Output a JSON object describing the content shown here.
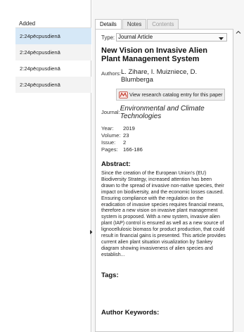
{
  "list": {
    "column_header": "Added",
    "rows": [
      "2:24pēcpusdienā",
      "2:24pēcpusdienā",
      "2:24pēcpusdienā",
      "2:24pēcpusdienā"
    ]
  },
  "tabs": [
    {
      "label": "Details"
    },
    {
      "label": "Notes"
    },
    {
      "label": "Contents"
    }
  ],
  "details": {
    "type_label": "Type:",
    "type_value": "Journal Article",
    "title": "New Vision on Invasive Alien Plant Management System",
    "authors_label": "Authors:",
    "authors_value": "L. Zihare, I. Muizniece, D. Blumberga",
    "catalog_button": "View research catalog entry for this paper",
    "journal_label": "Journal:",
    "journal_value": "Environmental and Climate Technologies",
    "year_label": "Year:",
    "year_value": "2019",
    "volume_label": "Volume:",
    "volume_value": "23",
    "issue_label": "Issue:",
    "issue_value": "2",
    "pages_label": "Pages:",
    "pages_value": "166-186",
    "abstract_heading": "Abstract:",
    "abstract_text": "Since the creation of the European Union's (EU) Biodiversity Strategy, increased attention has been drawn to the spread of invasive non-native species, their impact on biodiversity, and the economic losses caused. Ensuring compliance with the regulation on the eradication of invasive species requires financial means, therefore a new vision on invasive plant management system is proposed. With a new system, invasive alien plant (IAP) control is ensured as well as a new source of lignocellulosic biomass for product production, that could result in financial gains is presented. This article provides current alien plant situation visualization by Sankey diagram showing invasiveness of alien species and establish...",
    "tags_heading": "Tags:",
    "keywords_heading": "Author Keywords:"
  },
  "colors": {
    "selected_row": "#d6e8f7",
    "catalog_icon": "#c0392b"
  },
  "icons": {
    "dropdown": "chevron-down-icon",
    "catalog": "research-catalog-icon",
    "scroll": "scroll-up-arrow-icon"
  }
}
